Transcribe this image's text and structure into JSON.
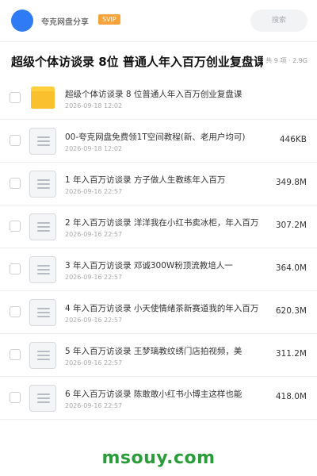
{
  "header": {
    "share_name": "夸克网盘分享",
    "badge": "SVIP",
    "search_placeholder": "搜索"
  },
  "folder": {
    "title": "超级个体访谈录 8位 普通人年入百万创业复盘课",
    "meta": "共 9 项 · 2.9G"
  },
  "files": [
    {
      "name": "超级个体访谈录 8 位普通人年入百万创业复盘课",
      "date": "2026-09-18 12:02",
      "size": "",
      "icon": "folder-icon"
    },
    {
      "name": "00-夸克网盘免费领1T空间教程(新、老用户均可)",
      "date": "2026-09-18 12:02",
      "size": "446KB",
      "icon": "document-icon"
    },
    {
      "name": "1  年入百万访谈录  方子做人生教练年入百万",
      "date": "2026-09-16 22:57",
      "size": "349.8M",
      "icon": "document-icon"
    },
    {
      "name": "2  年入百万访谈录  洋洋我在小红书卖冰柜，年入百万",
      "date": "2026-09-16 22:57",
      "size": "307.2M",
      "icon": "document-icon"
    },
    {
      "name": "3  年入百万访谈录  邓诚300W粉顶流教培人一",
      "date": "2026-09-16 22:57",
      "size": "364.0M",
      "icon": "document-icon"
    },
    {
      "name": "4  年入百万访谈录  小天使情绪茶新赛道我的年入百万",
      "date": "2026-09-16 22:57",
      "size": "620.3M",
      "icon": "document-icon"
    },
    {
      "name": "5  年入百万访谈录  王梦璃教纹绣门店拍视频，美",
      "date": "2026-09-16 22:57",
      "size": "311.2M",
      "icon": "document-icon"
    },
    {
      "name": "6  年入百万访谈录  陈敢敢小红书小博主这样也能",
      "date": "2026-09-16 22:57",
      "size": "418.0M",
      "icon": "document-icon"
    }
  ],
  "watermark": "msouy.com",
  "colors": {
    "avatar": "#2f7bf6",
    "svip_badge": "#f7a33a",
    "folder": "#fbc02d",
    "watermark": "#2a9d3a"
  }
}
